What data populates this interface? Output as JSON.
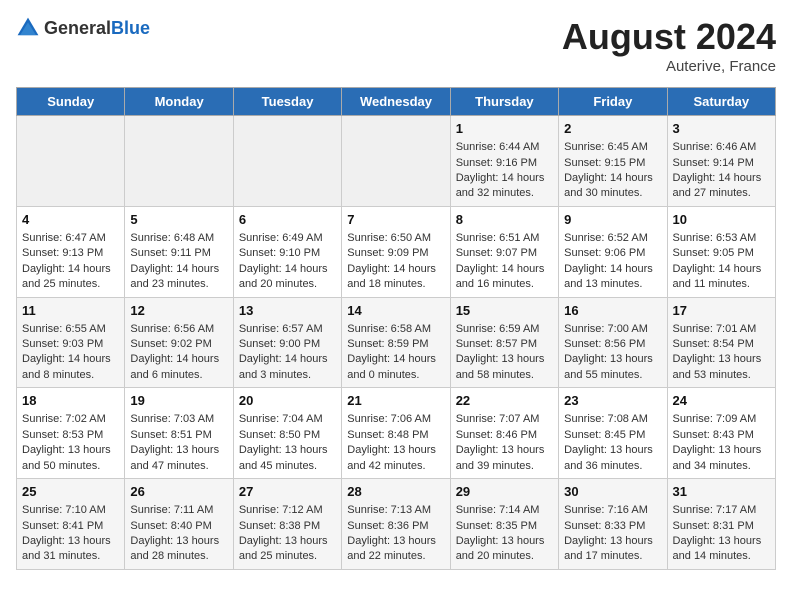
{
  "header": {
    "logo_general": "General",
    "logo_blue": "Blue",
    "title": "August 2024",
    "location": "Auterive, France"
  },
  "weekdays": [
    "Sunday",
    "Monday",
    "Tuesday",
    "Wednesday",
    "Thursday",
    "Friday",
    "Saturday"
  ],
  "weeks": [
    [
      {
        "day": "",
        "empty": true
      },
      {
        "day": "",
        "empty": true
      },
      {
        "day": "",
        "empty": true
      },
      {
        "day": "",
        "empty": true
      },
      {
        "day": "1",
        "sunrise": "6:44 AM",
        "sunset": "9:16 PM",
        "daylight": "14 hours and 32 minutes."
      },
      {
        "day": "2",
        "sunrise": "6:45 AM",
        "sunset": "9:15 PM",
        "daylight": "14 hours and 30 minutes."
      },
      {
        "day": "3",
        "sunrise": "6:46 AM",
        "sunset": "9:14 PM",
        "daylight": "14 hours and 27 minutes."
      }
    ],
    [
      {
        "day": "4",
        "sunrise": "6:47 AM",
        "sunset": "9:13 PM",
        "daylight": "14 hours and 25 minutes."
      },
      {
        "day": "5",
        "sunrise": "6:48 AM",
        "sunset": "9:11 PM",
        "daylight": "14 hours and 23 minutes."
      },
      {
        "day": "6",
        "sunrise": "6:49 AM",
        "sunset": "9:10 PM",
        "daylight": "14 hours and 20 minutes."
      },
      {
        "day": "7",
        "sunrise": "6:50 AM",
        "sunset": "9:09 PM",
        "daylight": "14 hours and 18 minutes."
      },
      {
        "day": "8",
        "sunrise": "6:51 AM",
        "sunset": "9:07 PM",
        "daylight": "14 hours and 16 minutes."
      },
      {
        "day": "9",
        "sunrise": "6:52 AM",
        "sunset": "9:06 PM",
        "daylight": "14 hours and 13 minutes."
      },
      {
        "day": "10",
        "sunrise": "6:53 AM",
        "sunset": "9:05 PM",
        "daylight": "14 hours and 11 minutes."
      }
    ],
    [
      {
        "day": "11",
        "sunrise": "6:55 AM",
        "sunset": "9:03 PM",
        "daylight": "14 hours and 8 minutes."
      },
      {
        "day": "12",
        "sunrise": "6:56 AM",
        "sunset": "9:02 PM",
        "daylight": "14 hours and 6 minutes."
      },
      {
        "day": "13",
        "sunrise": "6:57 AM",
        "sunset": "9:00 PM",
        "daylight": "14 hours and 3 minutes."
      },
      {
        "day": "14",
        "sunrise": "6:58 AM",
        "sunset": "8:59 PM",
        "daylight": "14 hours and 0 minutes."
      },
      {
        "day": "15",
        "sunrise": "6:59 AM",
        "sunset": "8:57 PM",
        "daylight": "13 hours and 58 minutes."
      },
      {
        "day": "16",
        "sunrise": "7:00 AM",
        "sunset": "8:56 PM",
        "daylight": "13 hours and 55 minutes."
      },
      {
        "day": "17",
        "sunrise": "7:01 AM",
        "sunset": "8:54 PM",
        "daylight": "13 hours and 53 minutes."
      }
    ],
    [
      {
        "day": "18",
        "sunrise": "7:02 AM",
        "sunset": "8:53 PM",
        "daylight": "13 hours and 50 minutes."
      },
      {
        "day": "19",
        "sunrise": "7:03 AM",
        "sunset": "8:51 PM",
        "daylight": "13 hours and 47 minutes."
      },
      {
        "day": "20",
        "sunrise": "7:04 AM",
        "sunset": "8:50 PM",
        "daylight": "13 hours and 45 minutes."
      },
      {
        "day": "21",
        "sunrise": "7:06 AM",
        "sunset": "8:48 PM",
        "daylight": "13 hours and 42 minutes."
      },
      {
        "day": "22",
        "sunrise": "7:07 AM",
        "sunset": "8:46 PM",
        "daylight": "13 hours and 39 minutes."
      },
      {
        "day": "23",
        "sunrise": "7:08 AM",
        "sunset": "8:45 PM",
        "daylight": "13 hours and 36 minutes."
      },
      {
        "day": "24",
        "sunrise": "7:09 AM",
        "sunset": "8:43 PM",
        "daylight": "13 hours and 34 minutes."
      }
    ],
    [
      {
        "day": "25",
        "sunrise": "7:10 AM",
        "sunset": "8:41 PM",
        "daylight": "13 hours and 31 minutes."
      },
      {
        "day": "26",
        "sunrise": "7:11 AM",
        "sunset": "8:40 PM",
        "daylight": "13 hours and 28 minutes."
      },
      {
        "day": "27",
        "sunrise": "7:12 AM",
        "sunset": "8:38 PM",
        "daylight": "13 hours and 25 minutes."
      },
      {
        "day": "28",
        "sunrise": "7:13 AM",
        "sunset": "8:36 PM",
        "daylight": "13 hours and 22 minutes."
      },
      {
        "day": "29",
        "sunrise": "7:14 AM",
        "sunset": "8:35 PM",
        "daylight": "13 hours and 20 minutes."
      },
      {
        "day": "30",
        "sunrise": "7:16 AM",
        "sunset": "8:33 PM",
        "daylight": "13 hours and 17 minutes."
      },
      {
        "day": "31",
        "sunrise": "7:17 AM",
        "sunset": "8:31 PM",
        "daylight": "13 hours and 14 minutes."
      }
    ]
  ],
  "labels": {
    "sunrise": "Sunrise:",
    "sunset": "Sunset:",
    "daylight": "Daylight:"
  }
}
